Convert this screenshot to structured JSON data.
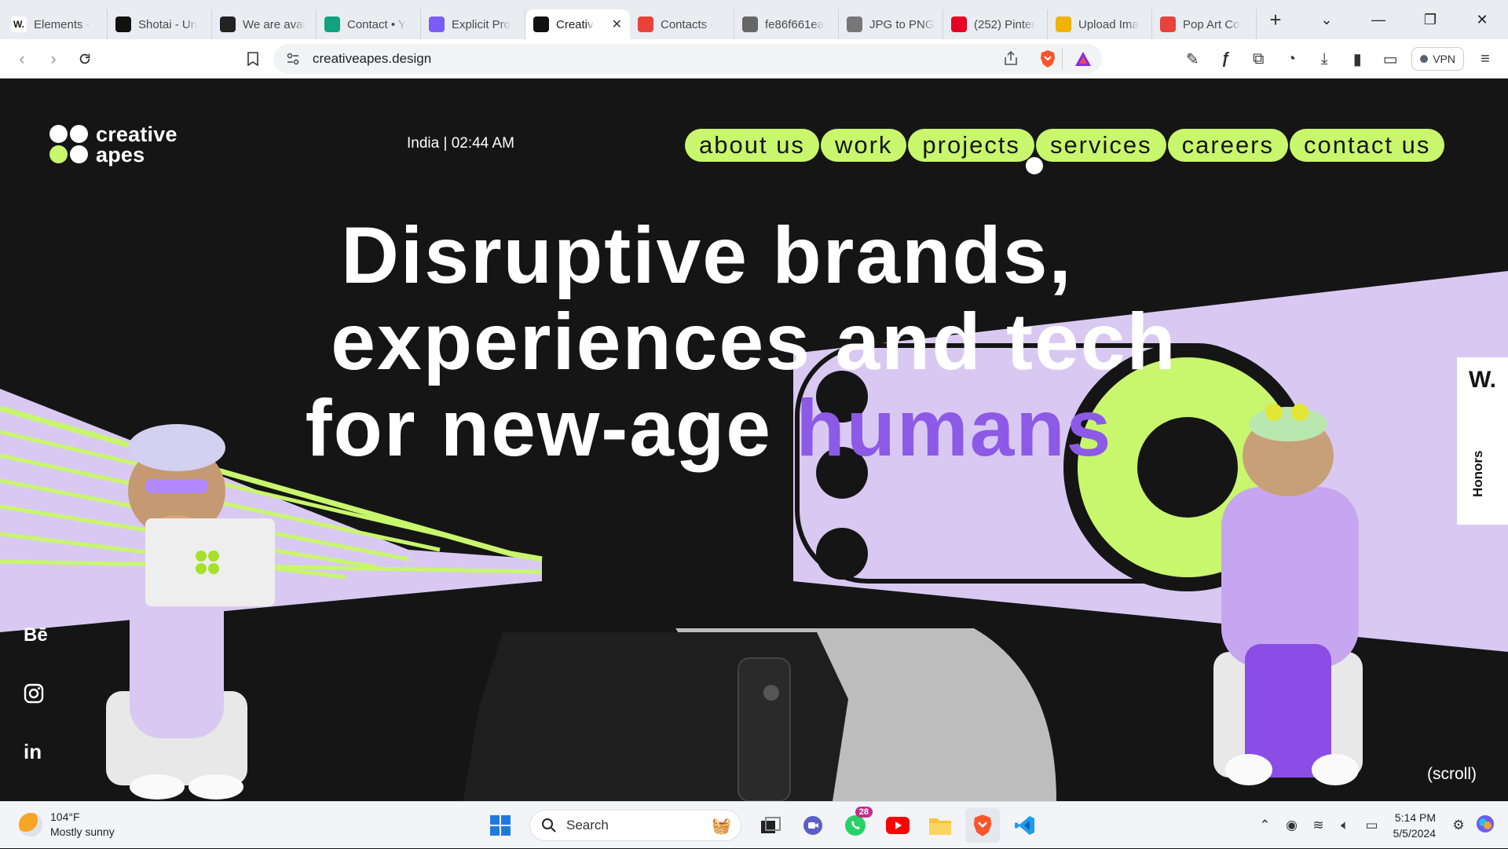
{
  "browser": {
    "tabs": [
      {
        "label": "Elements -",
        "icon": "webflow-w-icon",
        "color": "#ffffff"
      },
      {
        "label": "Shotai - Un",
        "icon": "shotai-icon",
        "color": "#111111"
      },
      {
        "label": "We are avai",
        "icon": "envato-icon",
        "color": "#222222"
      },
      {
        "label": "Contact • Y",
        "icon": "contact-green-icon",
        "color": "#10a37f"
      },
      {
        "label": "Explicit Pro",
        "icon": "explicit-purple-icon",
        "color": "#7b5cf5"
      },
      {
        "label": "Creativ",
        "icon": "creative-apes-icon",
        "color": "#111111",
        "active": true
      },
      {
        "label": "Contacts -",
        "icon": "contacts-red-icon",
        "color": "#e8423a"
      },
      {
        "label": "fe86f661ea",
        "icon": "globe-icon",
        "color": "#666666"
      },
      {
        "label": "JPG to PNG",
        "icon": "cloud-icon",
        "color": "#777777"
      },
      {
        "label": "(252) Pinter",
        "icon": "pinterest-icon",
        "color": "#e60023"
      },
      {
        "label": "Upload Ima",
        "icon": "upload-yellow-icon",
        "color": "#f0b400"
      },
      {
        "label": "Pop Art Co",
        "icon": "popart-red-icon",
        "color": "#e8423a"
      }
    ],
    "url": "creativeapes.design",
    "vpn_label": "VPN"
  },
  "site": {
    "logo_line1": "creative",
    "logo_line2": "apes",
    "clock": "India | 02:44 AM",
    "menu": [
      "about us",
      "work",
      "projects",
      "services",
      "careers",
      "contact us"
    ],
    "hero_line1": "Disruptive brands,",
    "hero_line2": "experiences and tech",
    "hero_line3_prefix": "for new-age ",
    "hero_line3_highlight": "humans",
    "social": [
      "Bē",
      "instagram",
      "in"
    ],
    "honors_mark": "W.",
    "honors_label": "Honors",
    "scroll_hint": "(scroll)",
    "colors": {
      "accent_lime": "#c8f66c",
      "accent_purple": "#8c5ae6",
      "lavender": "#d9c9f2",
      "bg": "#151515"
    }
  },
  "taskbar": {
    "weather_temp": "104°F",
    "weather_desc": "Mostly sunny",
    "search_placeholder": "Search",
    "whatsapp_badge": "28",
    "time": "5:14 PM",
    "date": "5/5/2024"
  }
}
